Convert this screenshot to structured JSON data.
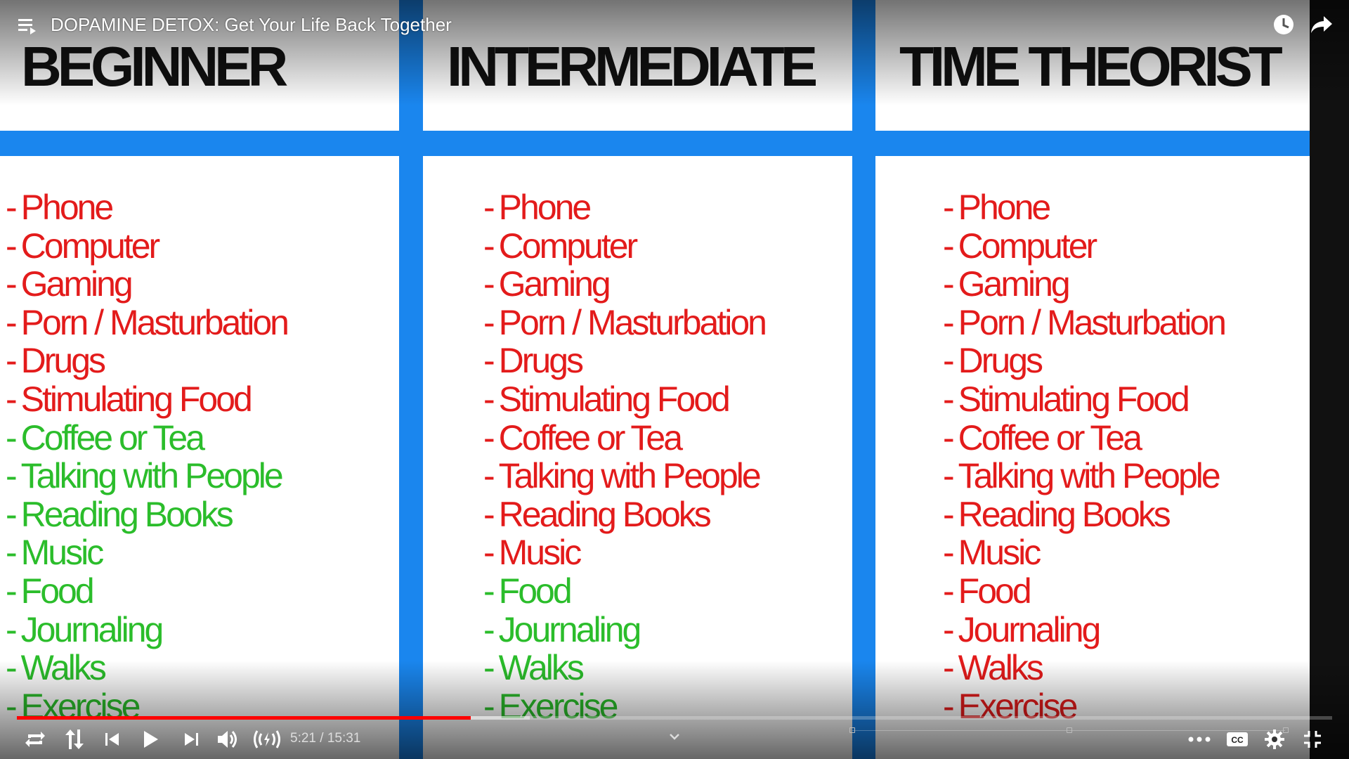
{
  "player": {
    "title": "DOPAMINE DETOX: Get Your Life Back Together",
    "time": {
      "current": "5:21",
      "separator": " / ",
      "duration": "15:31"
    },
    "progress": {
      "played_fraction": 0.345,
      "loaded_fraction": 0.39
    },
    "icons": {
      "playlist": "playlist-icon",
      "watch_later": "clock-icon",
      "share": "share-arrow-icon",
      "loop": "loop-icon",
      "sort": "up-down-arrows-icon",
      "previous": "skip-previous-icon",
      "play": "play-icon",
      "next": "skip-next-icon",
      "volume": "volume-icon",
      "live": "live-broadcast-icon",
      "chevron": "chevron-down-icon",
      "more": "more-dots-icon",
      "captions": "cc-icon",
      "settings": "gear-icon",
      "fullscreen_exit": "exit-fullscreen-icon"
    },
    "colors": {
      "progress_played": "#ff0000",
      "control_text": "#dddddd"
    }
  },
  "slide": {
    "colors": {
      "grid_blue": "#1a86ee",
      "heading": "#111111",
      "restricted": "#e31b1b",
      "allowed": "#2bbd2b"
    },
    "columns": [
      {
        "heading": "BEGINNER",
        "items": [
          {
            "text": "Phone",
            "status": "red"
          },
          {
            "text": "Computer",
            "status": "red"
          },
          {
            "text": "Gaming",
            "status": "red"
          },
          {
            "text": "Porn / Masturbation",
            "status": "red"
          },
          {
            "text": "Drugs",
            "status": "red"
          },
          {
            "text": "Stimulating Food",
            "status": "red"
          },
          {
            "text": "Coffee or Tea",
            "status": "green"
          },
          {
            "text": "Talking with People",
            "status": "green"
          },
          {
            "text": "Reading Books",
            "status": "green"
          },
          {
            "text": "Music",
            "status": "green"
          },
          {
            "text": "Food",
            "status": "green"
          },
          {
            "text": "Journaling",
            "status": "green"
          },
          {
            "text": "Walks",
            "status": "green"
          },
          {
            "text": "Exercise",
            "status": "green"
          }
        ]
      },
      {
        "heading": "INTERMEDIATE",
        "items": [
          {
            "text": "Phone",
            "status": "red"
          },
          {
            "text": "Computer",
            "status": "red"
          },
          {
            "text": "Gaming",
            "status": "red"
          },
          {
            "text": "Porn / Masturbation",
            "status": "red"
          },
          {
            "text": "Drugs",
            "status": "red"
          },
          {
            "text": "Stimulating Food",
            "status": "red"
          },
          {
            "text": "Coffee or Tea",
            "status": "red"
          },
          {
            "text": "Talking with People",
            "status": "red"
          },
          {
            "text": "Reading Books",
            "status": "red"
          },
          {
            "text": "Music",
            "status": "red"
          },
          {
            "text": "Food",
            "status": "green"
          },
          {
            "text": "Journaling",
            "status": "green"
          },
          {
            "text": "Walks",
            "status": "green"
          },
          {
            "text": "Exercise",
            "status": "green"
          }
        ]
      },
      {
        "heading": "TIME THEORIST",
        "items": [
          {
            "text": "Phone",
            "status": "red"
          },
          {
            "text": "Computer",
            "status": "red"
          },
          {
            "text": "Gaming",
            "status": "red"
          },
          {
            "text": "Porn / Masturbation",
            "status": "red"
          },
          {
            "text": "Drugs",
            "status": "red"
          },
          {
            "text": "Stimulating Food",
            "status": "red"
          },
          {
            "text": "Coffee or Tea",
            "status": "red"
          },
          {
            "text": "Talking with People",
            "status": "red"
          },
          {
            "text": "Reading Books",
            "status": "red"
          },
          {
            "text": "Music",
            "status": "red"
          },
          {
            "text": "Food",
            "status": "red"
          },
          {
            "text": "Journaling",
            "status": "red"
          },
          {
            "text": "Walks",
            "status": "red"
          },
          {
            "text": "Exercise",
            "status": "red"
          }
        ]
      }
    ]
  }
}
